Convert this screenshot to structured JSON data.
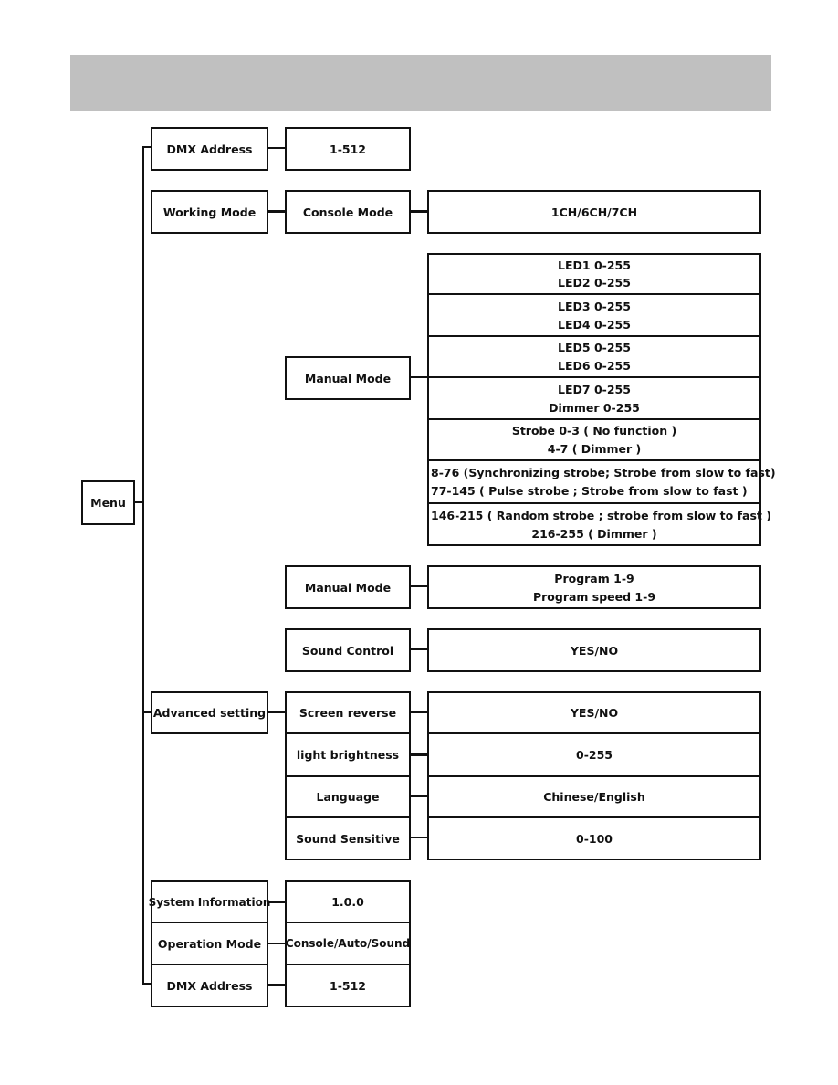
{
  "menu": "Menu",
  "rows": {
    "dmx_top": {
      "label": "DMX Address",
      "value": "1-512"
    },
    "working": {
      "label": "Working Mode",
      "console": "Console Mode",
      "console_value": "1CH/6CH/7CH",
      "manual": "Manual Mode",
      "manual_rows": [
        [
          "LED1 0-255",
          "LED2 0-255"
        ],
        [
          "LED3 0-255",
          "LED4 0-255"
        ],
        [
          "LED5 0-255",
          "LED6 0-255"
        ],
        [
          "LED7 0-255",
          "Dimmer 0-255"
        ],
        [
          "Strobe  0-3 ( No function )",
          "4-7 ( Dimmer )"
        ],
        [
          "8-76  (Synchronizing strobe; Strobe from slow to fast)",
          "77-145 ( Pulse strobe ; Strobe from slow to fast )"
        ],
        [
          "146-215 ( Random strobe ; strobe from slow to fast )",
          "216-255 ( Dimmer )"
        ]
      ],
      "manual2": "Manual Mode",
      "program": [
        "Program  1-9",
        "Program speed  1-9"
      ],
      "sound": "Sound Control",
      "sound_value": "YES/NO"
    },
    "advanced": {
      "label": "Advanced setting",
      "items": [
        {
          "label": "Screen reverse",
          "value": "YES/NO"
        },
        {
          "label": "light brightness",
          "value": "0-255"
        },
        {
          "label": "Language",
          "value": "Chinese/English"
        },
        {
          "label": "Sound Sensitive",
          "value": "0-100"
        }
      ]
    },
    "sysinfo": {
      "label": "System Information",
      "value": "1.0.0"
    },
    "opmode": {
      "label": "Operation Mode",
      "value": "Console/Auto/Sound"
    },
    "dmx_bottom": {
      "label": "DMX Address",
      "value": "1-512"
    }
  }
}
